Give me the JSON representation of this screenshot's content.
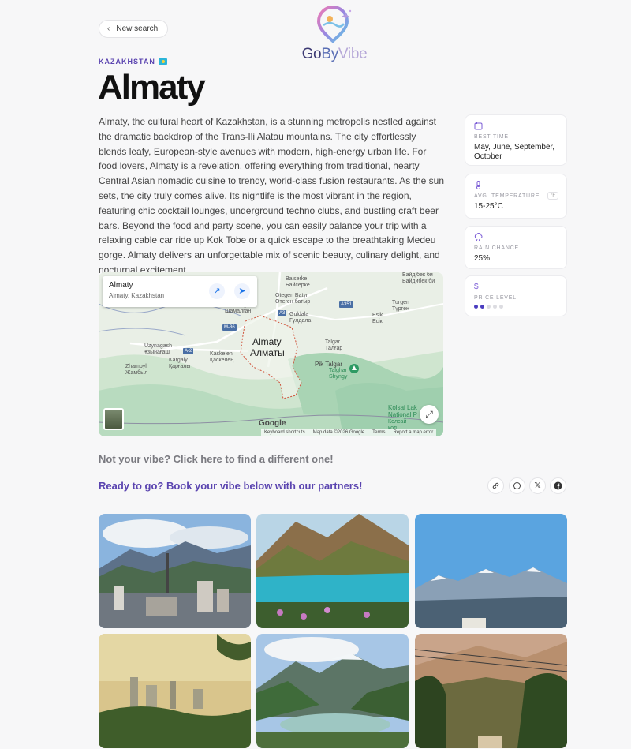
{
  "header": {
    "new_search_label": "New search",
    "logo": {
      "go": "Go",
      "by": "By",
      "vibe": "Vibe"
    }
  },
  "destination": {
    "country": "KAZAKHSTAN",
    "city": "Almaty",
    "description": "Almaty, the cultural heart of Kazakhstan, is a stunning metropolis nestled against the dramatic backdrop of the Trans-Ili Alatau mountains. The city effortlessly blends leafy, European-style avenues with modern, high-energy urban life. For food lovers, Almaty is a revelation, offering everything from traditional, hearty Central Asian nomadic cuisine to trendy, world-class fusion restaurants. As the sun sets, the city truly comes alive. Its nightlife is the most vibrant in the region, featuring chic cocktail lounges, underground techno clubs, and bustling craft beer bars. Beyond the food and party scene, you can easily balance your trip with a relaxing cable car ride up Kok Tobe or a quick escape to the breathtaking Medeu gorge. Almaty delivers an unforgettable mix of scenic beauty, culinary delight, and nocturnal excitement."
  },
  "info": {
    "best_time": {
      "icon": "calendar-icon",
      "label": "BEST TIME",
      "value": "May, June, September, October"
    },
    "avg_temp": {
      "icon": "thermometer-icon",
      "label": "AVG. TEMPERATURE",
      "value": "15-25°C",
      "unit_toggle": "°F"
    },
    "rain": {
      "icon": "cloud-rain-icon",
      "label": "RAIN CHANCE",
      "value": "25%"
    },
    "price": {
      "icon": "dollar-icon",
      "label": "PRICE LEVEL",
      "level": 2,
      "max": 5
    }
  },
  "map": {
    "place_name": "Almaty",
    "place_address": "Almaty, Kazakhstan",
    "city_label": "Almaty",
    "city_label_local": "Алматы",
    "labels": {
      "baiserke": "Baiserke",
      "baiserke_local": "Байсерке",
      "baidibek": "Байдібек би",
      "baidibek2": "Байдибек би",
      "otegen": "Otegen Batyr",
      "otegen_local": "Өтеген батыр",
      "shamalgan": "Shamalgan",
      "shamalgan_local": "Шамалган",
      "guldala": "Guldala",
      "guldala_local": "Гүлдала",
      "turgen": "Turgen",
      "turgen_local": "Түрген",
      "talgar": "Talgar",
      "talgar_local": "Талғар",
      "esik": "Esik",
      "esik_local": "Есік",
      "uzynagash": "Uzynagash",
      "uzynagash_local": "Ұзынағаш",
      "kargaly": "Kargaly",
      "kargaly_local": "Қарғалы",
      "kaskelen": "Kaskelen",
      "kaskelen_local": "Қаскелең",
      "zhambyl": "Zhambyl",
      "zhambyl_local": "Жамбыл",
      "pik_talgar": "Pik Talgar",
      "talgar_shyngy": "Talghar",
      "talgar_shyngy2": "Shyngy",
      "kolsai": "Kolsai Lak",
      "kolsai2": "National P",
      "kolsai3": "Көлсай",
      "kolsai4": "кол"
    },
    "roads": {
      "a3": "A3",
      "a351": "A351",
      "m36": "M-36",
      "a2": "A-2"
    },
    "google": "Google",
    "footer": [
      "Keyboard shortcuts",
      "Map data ©2026 Google",
      "Terms",
      "Report a map error"
    ]
  },
  "cta": {
    "not_vibe": "Not your vibe? Click here to find a different one!",
    "ready": "Ready to go? Book your vibe below with our partners!"
  },
  "share": {
    "link": "link-icon",
    "whatsapp": "whatsapp-icon",
    "x": "x-icon",
    "facebook": "facebook-icon"
  },
  "colors": {
    "accent": "#5b45b0",
    "background": "#f7f7f8"
  }
}
